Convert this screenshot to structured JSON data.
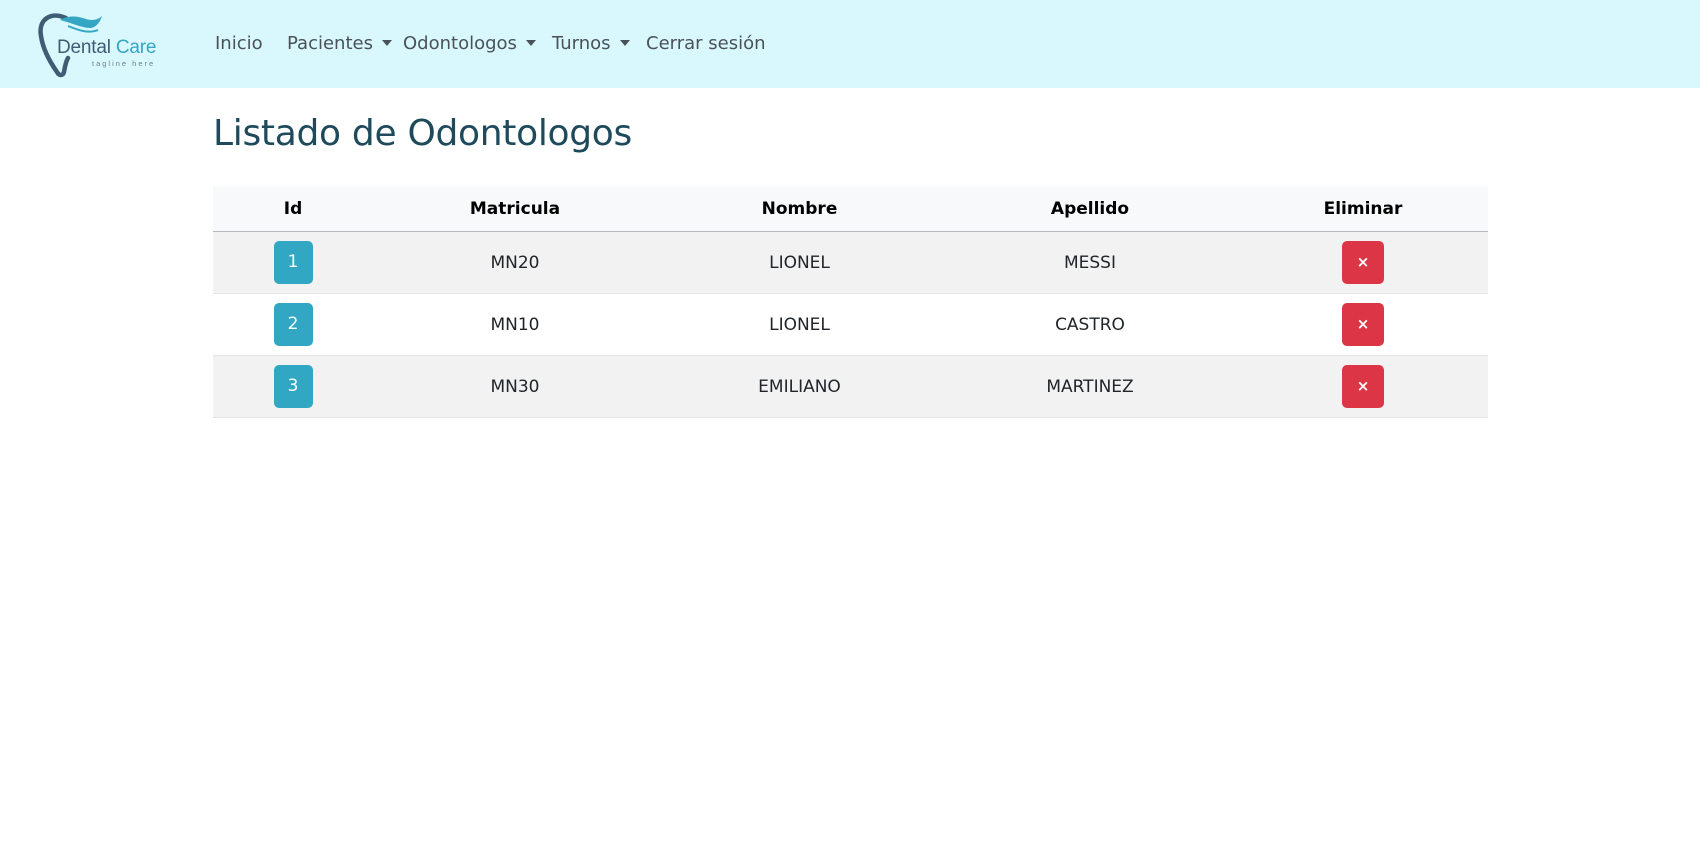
{
  "navbar": {
    "logo": {
      "name_part1": "Dental",
      "name_part2": "Care",
      "tagline": "tagline here",
      "colors": {
        "dark": "#3e5c74",
        "accent": "#35a6c4"
      }
    },
    "items": [
      {
        "label": "Inicio",
        "dropdown": false
      },
      {
        "label": "Pacientes",
        "dropdown": true
      },
      {
        "label": "Odontologos",
        "dropdown": true
      },
      {
        "label": "Turnos",
        "dropdown": true
      },
      {
        "label": "Cerrar sesión",
        "dropdown": false
      }
    ],
    "background": "#d8f8fe"
  },
  "main": {
    "title": "Listado de Odontologos",
    "table": {
      "headers": [
        "Id",
        "Matricula",
        "Nombre",
        "Apellido",
        "Eliminar"
      ],
      "rows": [
        {
          "id": "1",
          "matricula": "MN20",
          "nombre": "LIONEL",
          "apellido": "MESSI",
          "delete_label": "×"
        },
        {
          "id": "2",
          "matricula": "MN10",
          "nombre": "LIONEL",
          "apellido": "CASTRO",
          "delete_label": "×"
        },
        {
          "id": "3",
          "matricula": "MN30",
          "nombre": "EMILIANO",
          "apellido": "MARTINEZ",
          "delete_label": "×"
        }
      ]
    }
  },
  "colors": {
    "title": "#1e4a5c",
    "id_button": "#31a7c4",
    "delete_button": "#dc3545"
  }
}
